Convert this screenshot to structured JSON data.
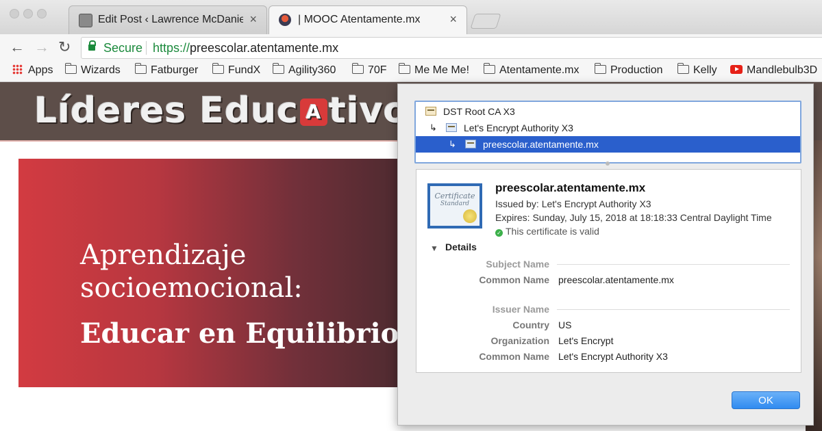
{
  "window": {
    "tabs": [
      {
        "title": "Edit Post ‹ Lawrence McDaniel",
        "close": "×"
      },
      {
        "title": "| MOOC Atentamente.mx",
        "close": "×"
      }
    ]
  },
  "toolbar": {
    "back": "←",
    "forward": "→",
    "reload": "↻",
    "secure_label": "Secure",
    "url_scheme": "https://",
    "url_host": "preescolar.atentamente.mx"
  },
  "bookmarks": [
    "Apps",
    "Wizards",
    "Fatburger",
    "FundX",
    "Agility360",
    "70F",
    "Me Me Me!",
    "Atentamente.mx",
    "Production",
    "Kelly",
    "Mandlebulb3D"
  ],
  "page": {
    "logo_pre": "Líderes Educ",
    "logo_box": "A",
    "logo_post": "tivos",
    "hero": {
      "line1": "Aprendizaje",
      "line2": "socioemocional:",
      "line3": "Educar en Equilibrio"
    }
  },
  "certificate": {
    "chain": [
      "DST Root CA X3",
      "Let's Encrypt Authority X3",
      "preescolar.atentamente.mx"
    ],
    "icon_text_1": "Certificate",
    "icon_text_2": "Standard",
    "name": "preescolar.atentamente.mx",
    "issued_by": "Issued by: Let's Encrypt Authority X3",
    "expires": "Expires: Sunday, July 15, 2018 at 18:18:33 Central Daylight Time",
    "valid": "This certificate is valid",
    "details_label": "Details",
    "subject_name": "Subject Name",
    "subject_cn_label": "Common Name",
    "subject_cn": "preescolar.atentamente.mx",
    "issuer_name": "Issuer Name",
    "country_label": "Country",
    "country": "US",
    "org_label": "Organization",
    "org": "Let's Encrypt",
    "issuer_cn_label": "Common Name",
    "issuer_cn": "Let's Encrypt Authority X3",
    "ok": "OK"
  },
  "colors": {
    "secure_green": "#1b8a3c",
    "selection_blue": "#2a5fcc",
    "hero_red": "#d23b41",
    "ok_blue": "#2f8bf0"
  }
}
